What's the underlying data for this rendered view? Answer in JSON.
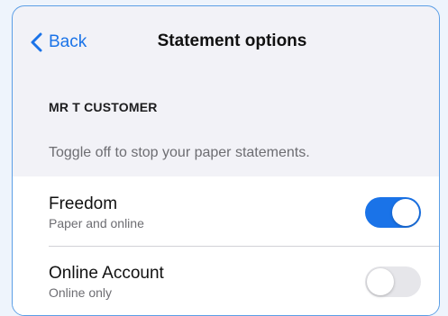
{
  "navbar": {
    "back_label": "Back",
    "title": "Statement options"
  },
  "section": {
    "header": "MR T CUSTOMER",
    "note": "Toggle off to stop your paper statements."
  },
  "accounts": [
    {
      "name": "Freedom",
      "subtitle": "Paper and online",
      "paper_statements": true
    },
    {
      "name": "Online Account",
      "subtitle": "Online only",
      "paper_statements": false
    }
  ],
  "colors": {
    "accent": "#1a73e8",
    "toggle_off": "#e6e6ea",
    "background": "#f2f2f7"
  }
}
